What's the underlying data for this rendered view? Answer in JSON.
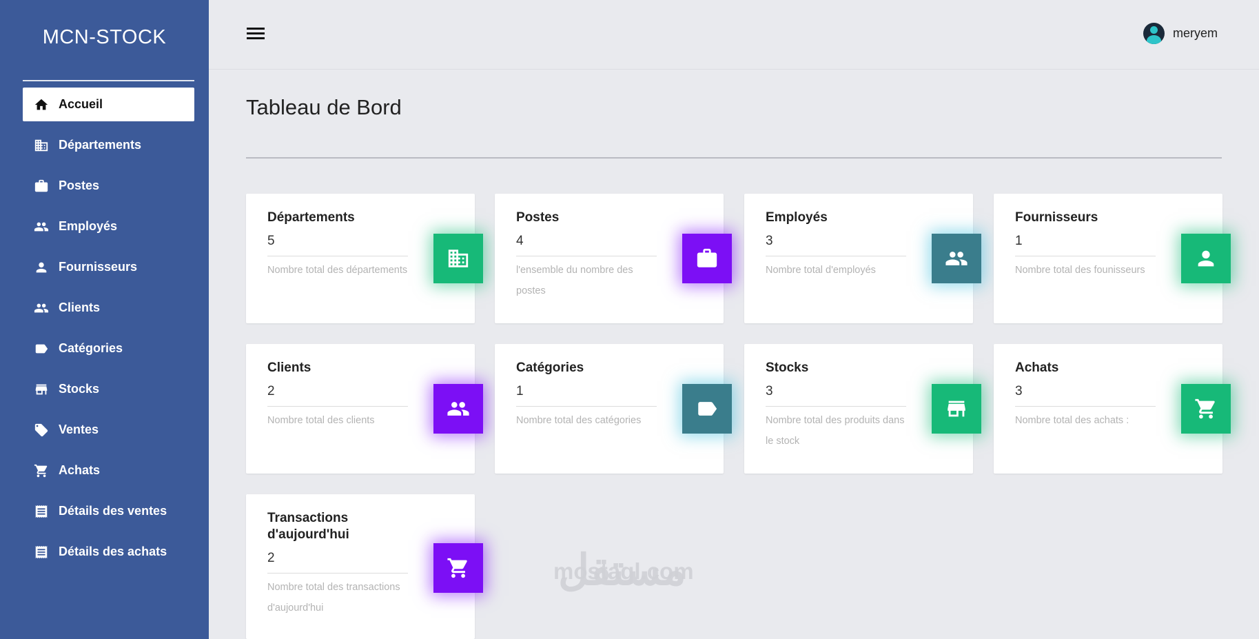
{
  "app": {
    "brand": "MCN-STOCK"
  },
  "sidebar": {
    "items": [
      {
        "label": "Accueil",
        "icon": "home-icon",
        "active": true
      },
      {
        "label": "Départements",
        "icon": "building-icon"
      },
      {
        "label": "Postes",
        "icon": "briefcase-icon"
      },
      {
        "label": "Employés",
        "icon": "people-icon"
      },
      {
        "label": "Fournisseurs",
        "icon": "person-icon"
      },
      {
        "label": "Clients",
        "icon": "people-icon"
      },
      {
        "label": "Catégories",
        "icon": "label-icon"
      },
      {
        "label": "Stocks",
        "icon": "store-icon"
      },
      {
        "label": "Ventes",
        "icon": "tag-icon"
      },
      {
        "label": "Achats",
        "icon": "cart-icon"
      },
      {
        "label": "Détails des ventes",
        "icon": "receipt-icon"
      },
      {
        "label": "Détails des achats",
        "icon": "receipt-icon"
      }
    ]
  },
  "header": {
    "username": "meryem",
    "menu_icon": "hamburger-icon",
    "avatar_icon": "user-avatar-icon"
  },
  "main": {
    "title": "Tableau de Bord",
    "cards": [
      {
        "title": "Départements",
        "value": "5",
        "desc": "Nombre total des départements",
        "icon": "building-icon",
        "color": "#17b978"
      },
      {
        "title": "Postes",
        "value": "4",
        "desc": "l'ensemble du nombre des postes",
        "icon": "briefcase-icon",
        "color": "#7c0ff5"
      },
      {
        "title": "Employés",
        "value": "3",
        "desc": "Nombre total d'employés",
        "icon": "people-icon",
        "color": "#3a7d8c"
      },
      {
        "title": "Fournisseurs",
        "value": "1",
        "desc": "Nombre total des founisseurs",
        "icon": "person-icon",
        "color": "#17b978"
      },
      {
        "title": "Clients",
        "value": "2",
        "desc": "Nombre total des clients",
        "icon": "people-icon",
        "color": "#7c0ff5"
      },
      {
        "title": "Catégories",
        "value": "1",
        "desc": "Nombre total des catégories",
        "icon": "label-icon",
        "color": "#3a7d8c"
      },
      {
        "title": "Stocks",
        "value": "3",
        "desc": "Nombre total des produits dans le stock",
        "icon": "store-icon",
        "color": "#17b978"
      },
      {
        "title": "Achats",
        "value": "3",
        "desc": "Nombre total des achats :",
        "icon": "cart-icon",
        "color": "#17b978"
      },
      {
        "title": "Transactions d'aujourd'hui",
        "value": "2",
        "desc": "Nombre total des transactions d'aujourd'hui",
        "icon": "cart-icon",
        "color": "#7c0ff5"
      }
    ]
  },
  "watermark": {
    "arabic": "مستقل",
    "latin": "mostaql.com"
  }
}
